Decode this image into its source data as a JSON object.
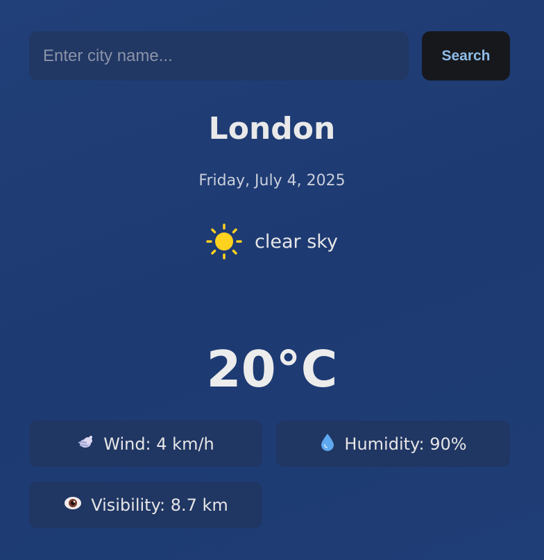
{
  "search": {
    "placeholder": "Enter city name...",
    "value": "",
    "button_label": "Search"
  },
  "weather": {
    "city": "London",
    "date": "Friday, July 4, 2025",
    "condition_icon": "sun-icon",
    "condition": "clear sky",
    "temperature": "20°C"
  },
  "stats": {
    "wind": {
      "icon": "wind-icon",
      "label": "Wind: 4 km/h"
    },
    "humidity": {
      "icon": "droplet-icon",
      "label": "Humidity: 90%"
    },
    "visibility": {
      "icon": "eye-icon",
      "label": "Visibility: 8.7 km"
    }
  },
  "colors": {
    "background": "#1f3c75",
    "card": "#203663",
    "button": "#17181c",
    "button_text": "#8fbde8",
    "sun": "#ffd21f"
  }
}
